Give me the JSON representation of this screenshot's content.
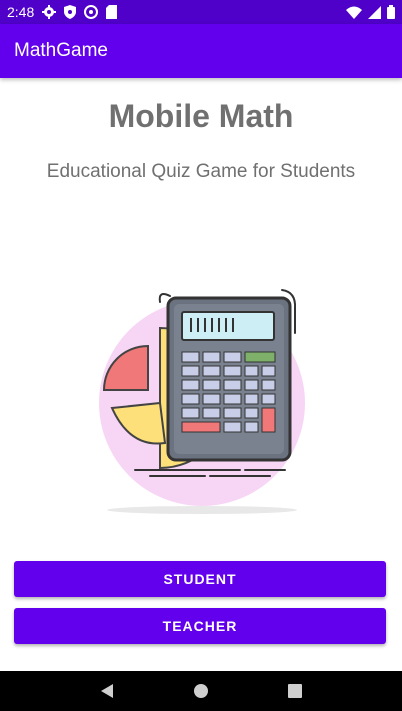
{
  "status_bar": {
    "time": "2:48",
    "icons": [
      "settings-icon",
      "shield-icon",
      "at-sign-icon",
      "sd-card-icon",
      "wifi-icon",
      "signal-icon",
      "battery-icon"
    ]
  },
  "app_bar": {
    "title": "MathGame"
  },
  "main": {
    "title": "Mobile Math",
    "subtitle": "Educational Quiz Game for Students",
    "illustration": "calculator-with-pie-chart"
  },
  "buttons": {
    "student_label": "STUDENT",
    "teacher_label": "TEACHER"
  },
  "nav_bar": {
    "icons": [
      "back-icon",
      "home-icon",
      "recents-icon"
    ]
  },
  "colors": {
    "primary": "#6200ee",
    "primary_dark": "#4f00c9",
    "text_gray": "#707070"
  }
}
